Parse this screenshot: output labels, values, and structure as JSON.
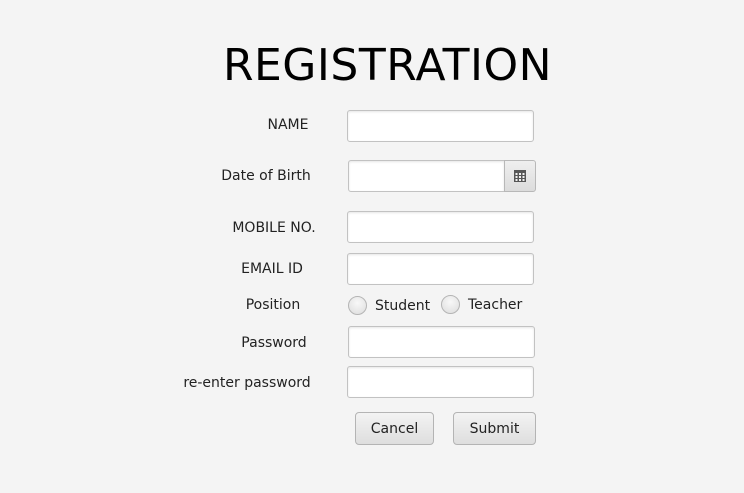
{
  "form": {
    "title": "REGISTRATION",
    "fields": {
      "name": {
        "label": "NAME",
        "value": ""
      },
      "dob": {
        "label": "Date of Birth",
        "value": "",
        "picker_icon": "calendar-icon"
      },
      "mobile": {
        "label": "MOBILE NO.",
        "value": ""
      },
      "email": {
        "label": "EMAIL ID",
        "value": ""
      },
      "position": {
        "label": "Position",
        "options": [
          {
            "label": "Student",
            "selected": false
          },
          {
            "label": "Teacher",
            "selected": false
          }
        ]
      },
      "password": {
        "label": "Password",
        "value": ""
      },
      "reenter_password": {
        "label": "re-enter password",
        "value": ""
      }
    },
    "buttons": {
      "cancel": "Cancel",
      "submit": "Submit"
    }
  }
}
